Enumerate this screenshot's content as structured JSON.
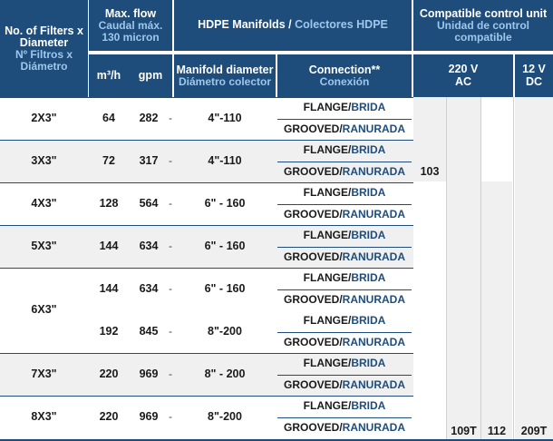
{
  "header": {
    "filters": {
      "en": "No. of Filters x Diameter",
      "es": "Nº Filtros x Diámetro"
    },
    "maxflow": {
      "en": "Max. flow",
      "es": "Caudal máx.",
      "note": "130 micron"
    },
    "m3h": "m³/h",
    "gpm": "gpm",
    "hdpe": {
      "en": "HDPE Manifolds",
      "sep": " / ",
      "es": "Colectores HDPE"
    },
    "manifold_diameter": {
      "en": "Manifold diameter",
      "es": "Diámetro colector"
    },
    "connection": {
      "en": "Connection**",
      "es": "Conexión"
    },
    "compatible": {
      "en": "Compatible control unit",
      "es": "Unidad de control compatible"
    },
    "v220": {
      "line1": "220 V",
      "line2": "AC"
    },
    "v12": {
      "line1": "12 V",
      "line2": "DC"
    }
  },
  "connection_labels": {
    "flange_en": "FLANGE",
    "flange_es": "BRIDA",
    "grooved_en": "GROOVED",
    "grooved_es": "RANURADA",
    "slash": "/"
  },
  "dash": "-",
  "rows": [
    {
      "filters": "2X3\"",
      "flows": [
        {
          "m3h": "64",
          "gpm": "282",
          "diameter": "4\"-110"
        }
      ]
    },
    {
      "filters": "3X3\"",
      "flows": [
        {
          "m3h": "72",
          "gpm": "317",
          "diameter": "4\"-110"
        }
      ]
    },
    {
      "filters": "4X3\"",
      "flows": [
        {
          "m3h": "128",
          "gpm": "564",
          "diameter": "6\" - 160"
        }
      ]
    },
    {
      "filters": "5X3\"",
      "flows": [
        {
          "m3h": "144",
          "gpm": "634",
          "diameter": "6\" - 160"
        }
      ]
    },
    {
      "filters": "6X3\"",
      "flows": [
        {
          "m3h": "144",
          "gpm": "634",
          "diameter": "6\" - 160"
        },
        {
          "m3h": "192",
          "gpm": "845",
          "diameter": "8\"-200"
        }
      ]
    },
    {
      "filters": "7X3\"",
      "flows": [
        {
          "m3h": "220",
          "gpm": "969",
          "diameter": "8\" - 200"
        }
      ]
    },
    {
      "filters": "8X3\"",
      "flows": [
        {
          "m3h": "220",
          "gpm": "969",
          "diameter": "8\"-200"
        }
      ]
    }
  ],
  "control_units": {
    "c103": "103",
    "c109t": "109T",
    "c112": "112",
    "c209t": "209T"
  }
}
